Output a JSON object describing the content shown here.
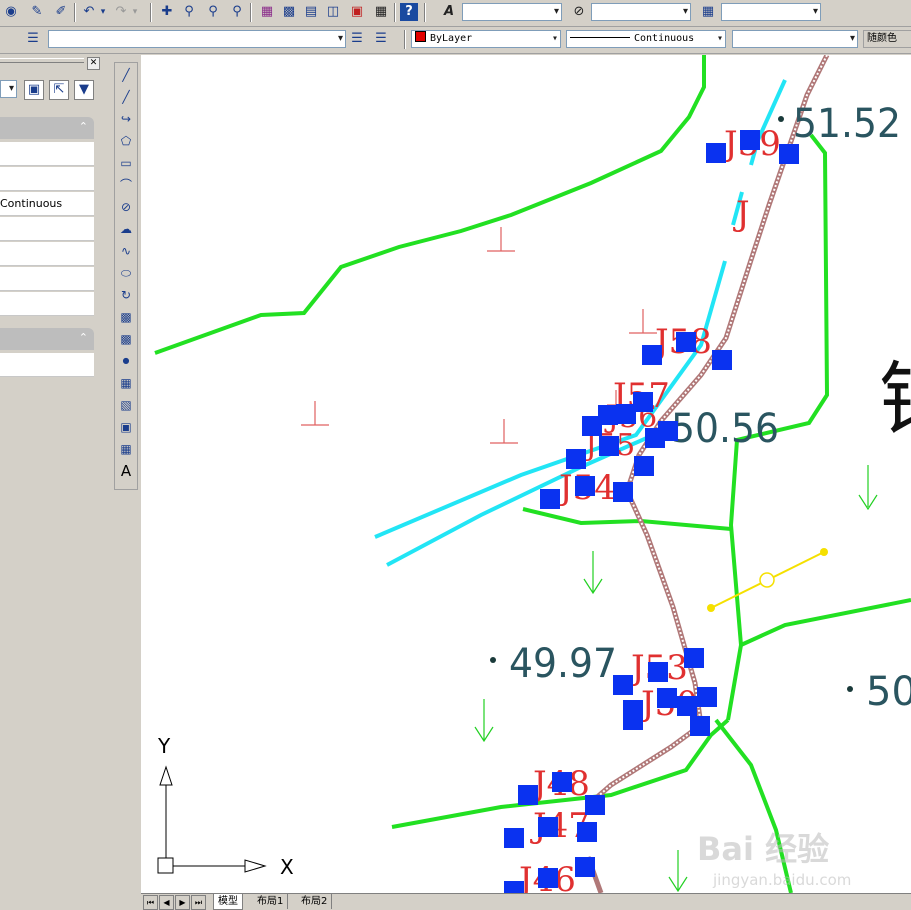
{
  "toolbar2": {
    "layer_value": "",
    "color_value": "ByLayer",
    "linetype_value": "Continuous",
    "lineweight_value": "",
    "plotstyle_label": "随颜色"
  },
  "properties_panel": {
    "linetype_row": "Continuous"
  },
  "drawing": {
    "elevations": [
      "51.52",
      "50.56",
      "49.97",
      "50"
    ],
    "nodes": [
      "J59",
      "J58",
      "J57",
      "J56",
      "J55",
      "J54",
      "J53",
      "J50",
      "J48",
      "J47",
      "J46"
    ],
    "stray_label": "J",
    "glyph_large": "锚",
    "axis_x": "X",
    "axis_y": "Y"
  },
  "tabs": [
    "模型",
    "布局1",
    "布局2"
  ],
  "watermark": {
    "brand": "Bai 经验",
    "url": "jingyan.baidu.com"
  },
  "colors": {
    "green_line": "#22e022",
    "cyan_line": "#22e5f5",
    "node_square": "#0a32f0",
    "node_label": "#e03030",
    "pipe": "#b08080",
    "elev_text": "#2a5560",
    "yellow": "#f5e000"
  }
}
